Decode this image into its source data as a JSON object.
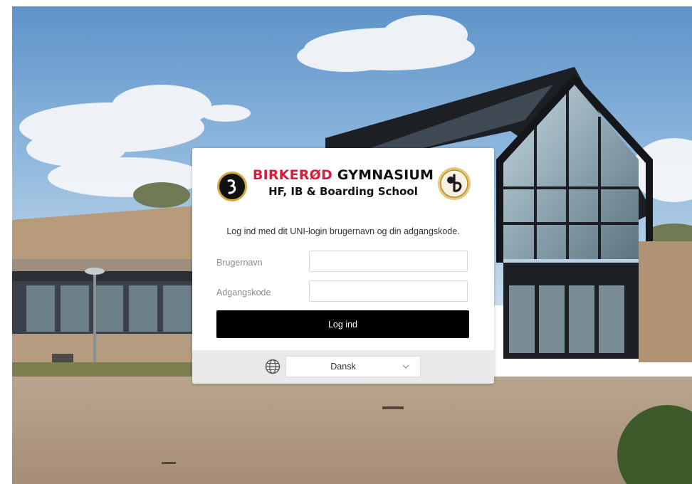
{
  "school": {
    "name_part1": "BIRKERØD",
    "name_part2": "GYMNASIUM",
    "subtitle": "HF, IB & Boarding School"
  },
  "login": {
    "instruction": "Log ind med dit UNI-login brugernavn og din adgangskode.",
    "username_label": "Brugernavn",
    "username_value": "",
    "password_label": "Adgangskode",
    "password_value": "",
    "submit_label": "Log ind"
  },
  "language": {
    "icon": "globe-icon",
    "selected": "Dansk"
  },
  "colors": {
    "brand_red": "#d81e3a",
    "button_bg": "#000000",
    "footer_bg": "#e9e9e9"
  }
}
